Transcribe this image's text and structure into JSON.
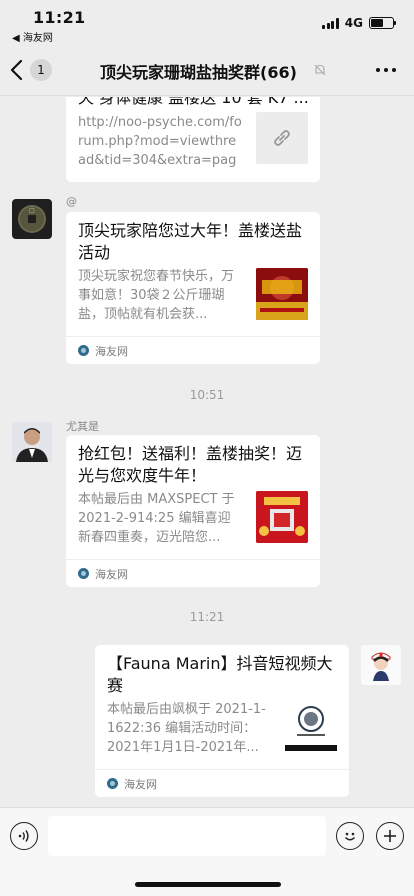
{
  "status_bar": {
    "time": "11:21",
    "back_app": "◀ 海友网",
    "network": "4G"
  },
  "nav": {
    "back_count": "1",
    "title": "顶尖玩家珊瑚盐抽奖群(66)"
  },
  "messages": {
    "card0": {
      "title_partial": "天 身体健康 盖楼送 10 套 K7 ...",
      "desc": "http://noo-psyche.com/forum.php?mod=viewthread&tid=304&extra=page..."
    },
    "msg1": {
      "sender": "@",
      "title": "顶尖玩家陪您过大年！盖楼送盐活动",
      "desc": "顶尖玩家祝您春节快乐，万事如意！30袋２公斤珊瑚盐，顶帖就有机会获...",
      "source": "海友网"
    },
    "time1": "10:51",
    "msg2": {
      "sender": "尤其是",
      "title": "抢红包！送福利！盖楼抽奖！迈光与您欢度牛年！",
      "desc": "本帖最后由 MAXSPECT 于 2021-2-914:25 编辑喜迎新春四重奏，迈光陪您...",
      "source": "海友网"
    },
    "time2": "11:21",
    "msg3": {
      "title": "【Fauna Marin】抖音短视频大赛",
      "desc": "本帖最后由飒枫于 2021-1-1622:36 编辑活动时间：2021年1月1日-2021年...",
      "source": "海友网"
    }
  },
  "colors": {
    "background": "#ededed",
    "card": "#ffffff",
    "muted": "#8a8a8a"
  }
}
